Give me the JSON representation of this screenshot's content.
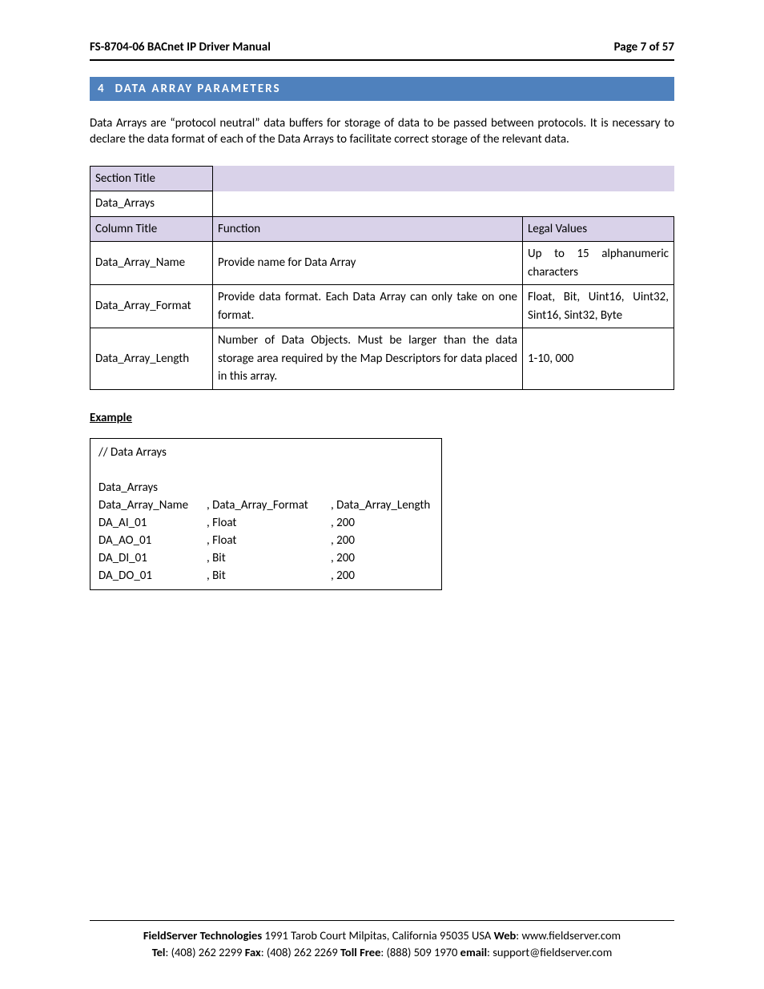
{
  "header": {
    "title": "FS-8704-06 BACnet IP Driver Manual",
    "page": "Page 7 of 57"
  },
  "section": {
    "number": "4",
    "title": "DATA ARRAY PARAMETERS"
  },
  "intro": "Data Arrays are “protocol neutral” data buffers for storage of data to be passed between protocols.  It is necessary to declare the data format of each of the Data Arrays to facilitate correct storage of the relevant data.",
  "table": {
    "sectionTitleLabel": "Section Title",
    "sectionTitleValue": "Data_Arrays",
    "colTitleLabel": "Column Title",
    "funcLabel": "Function",
    "legalLabel": "Legal Values",
    "rows": [
      {
        "name": "Data_Array_Name",
        "func": "Provide name for Data Array",
        "legal": "Up to 15 alphanumeric characters"
      },
      {
        "name": "Data_Array_Format",
        "func": "Provide data format.  Each Data Array can only take on one format.",
        "legal": "Float, Bit, Uint16, Uint32, Sint16, Sint32, Byte"
      },
      {
        "name": "Data_Array_Length",
        "func": "Number of Data Objects.  Must be larger than the data storage area required by the Map Descriptors for data placed in this array.",
        "legal": "1-10, 000"
      }
    ]
  },
  "exampleLabel": "Example",
  "example": {
    "comment": "//     Data Arrays",
    "section": "Data_Arrays",
    "headers": [
      "Data_Array_Name",
      ", Data_Array_Format",
      ", Data_Array_Length"
    ],
    "rows": [
      [
        "DA_AI_01",
        ", Float",
        ", 200"
      ],
      [
        "DA_AO_01",
        ", Float",
        ", 200"
      ],
      [
        "DA_DI_01",
        ", Bit",
        ", 200"
      ],
      [
        "DA_DO_01",
        ", Bit",
        ", 200"
      ]
    ]
  },
  "footer": {
    "companyBold": "FieldServer Technologies",
    "address": " 1991 Tarob Court Milpitas, California 95035 USA   ",
    "webLabel": "Web",
    "web": ": www.fieldserver.com",
    "telLabel": "Tel",
    "tel": ": (408) 262 2299   ",
    "faxLabel": "Fax",
    "fax": ": (408) 262 2269   ",
    "tollFreeLabel": "Toll Free",
    "tollFree": ": (888) 509 1970   ",
    "emailLabel": "email",
    "email": ": support@fieldserver.com"
  }
}
